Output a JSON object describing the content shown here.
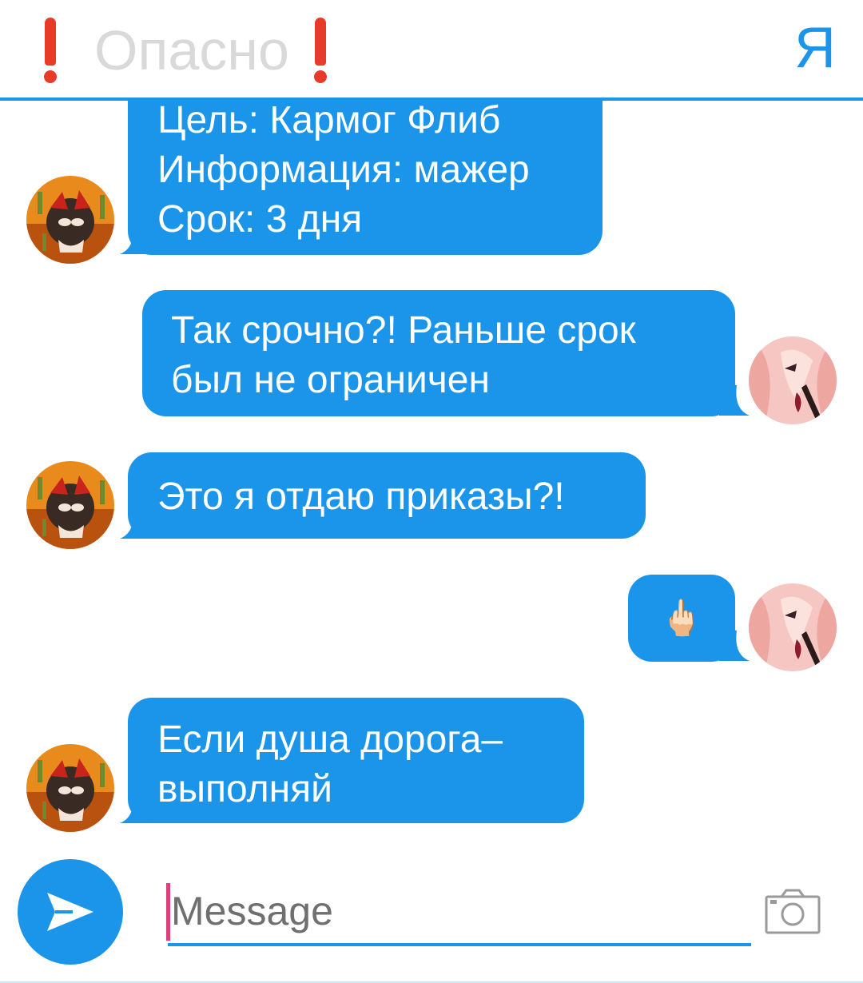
{
  "header": {
    "title": "Опасно",
    "right_label": "Я",
    "alert_icon": "exclamation-mark-icon",
    "accent_color": "#1a95ea"
  },
  "messages": [
    {
      "side": "left",
      "lines": [
        "Цель: Кармог Флиб",
        "Информация: мажер",
        "Срок: 3 дня"
      ]
    },
    {
      "side": "right",
      "lines": [
        "Так срочно?! Раньше срок",
        "был не ограничен"
      ]
    },
    {
      "side": "left",
      "lines": [
        "Это я отдаю приказы?!"
      ]
    },
    {
      "side": "right",
      "lines": [
        "🖕🏻"
      ]
    },
    {
      "side": "left",
      "lines": [
        "Если душа дорога–",
        "выполняй"
      ]
    }
  ],
  "composer": {
    "placeholder": "Message",
    "send_icon": "send-arrow-icon",
    "camera_icon": "camera-icon"
  }
}
